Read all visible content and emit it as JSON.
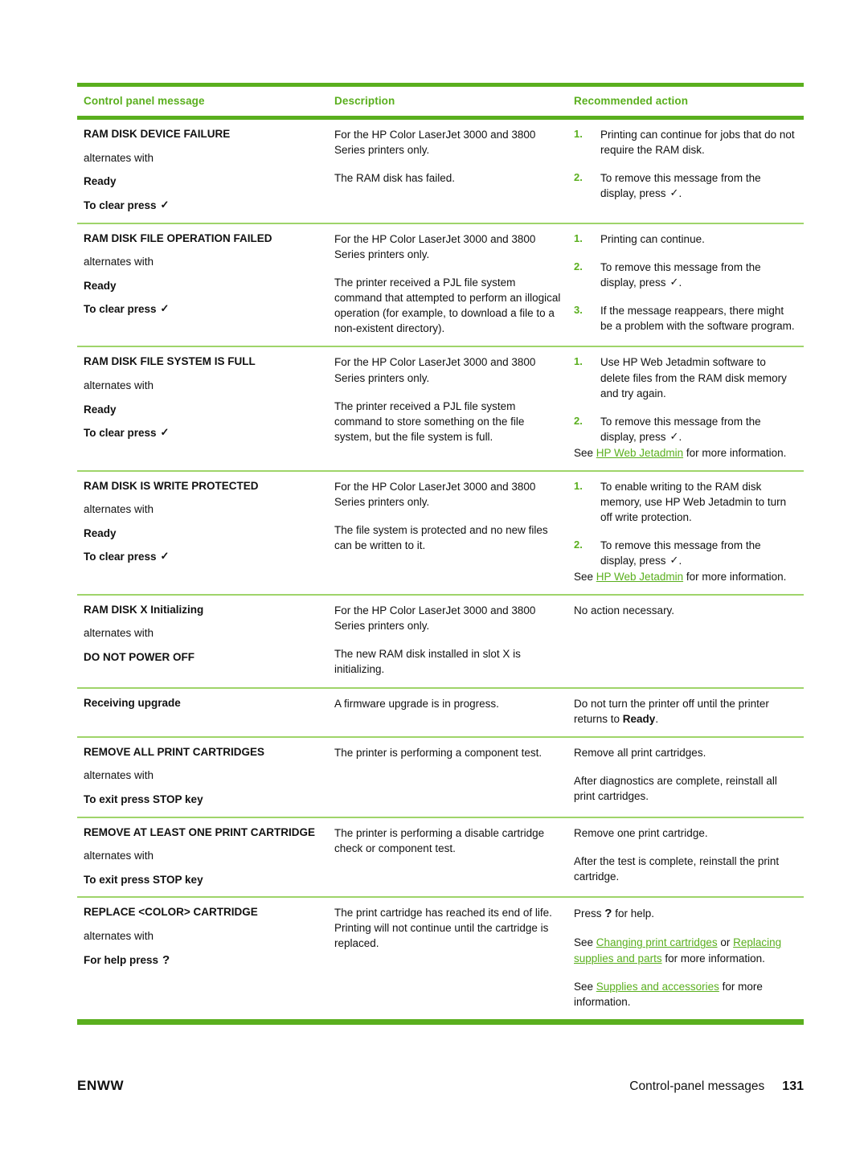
{
  "document": {
    "table": {
      "headers": {
        "col1": "Control panel message",
        "col2": "Description",
        "col3": "Recommended action"
      },
      "rows": [
        {
          "message": {
            "lines": [
              {
                "text": "RAM DISK DEVICE FAILURE",
                "style": "bold"
              },
              {
                "text": "alternates with",
                "style": "plain"
              },
              {
                "text": "Ready",
                "style": "bold"
              },
              {
                "text": "To clear press",
                "style": "bold",
                "glyph": "check"
              }
            ]
          },
          "description": [
            "For the HP Color LaserJet 3000 and 3800 Series printers only.",
            "The RAM disk has failed."
          ],
          "action_type": "list",
          "action_items": [
            {
              "num": "1.",
              "text": "Printing can continue for jobs that do not require the RAM disk."
            },
            {
              "num": "2.",
              "text": "To remove this message from the display, press",
              "glyph": "check",
              "tail": "."
            }
          ],
          "action_notes": []
        },
        {
          "message": {
            "lines": [
              {
                "text": "RAM DISK FILE OPERATION FAILED",
                "style": "bold"
              },
              {
                "text": "alternates with",
                "style": "plain"
              },
              {
                "text": "Ready",
                "style": "bold"
              },
              {
                "text": "To clear press",
                "style": "bold",
                "glyph": "check"
              }
            ]
          },
          "description": [
            "For the HP Color LaserJet 3000 and 3800 Series printers only.",
            "The printer received a PJL file system command that attempted to perform an illogical operation (for example, to download a file to a non-existent directory)."
          ],
          "action_type": "list",
          "action_items": [
            {
              "num": "1.",
              "text": "Printing can continue."
            },
            {
              "num": "2.",
              "text": "To remove this message from the display, press",
              "glyph": "check",
              "tail": "."
            },
            {
              "num": "3.",
              "text": "If the message reappears, there might be a problem with the software program."
            }
          ],
          "action_notes": []
        },
        {
          "message": {
            "lines": [
              {
                "text": "RAM DISK FILE SYSTEM IS FULL",
                "style": "bold"
              },
              {
                "text": "alternates with",
                "style": "plain"
              },
              {
                "text": "Ready",
                "style": "bold"
              },
              {
                "text": "To clear press",
                "style": "bold",
                "glyph": "check"
              }
            ]
          },
          "description": [
            "For the HP Color LaserJet 3000 and 3800 Series printers only.",
            "The printer received a PJL file system command to store something on the file system, but the file system is full."
          ],
          "action_type": "list",
          "action_items": [
            {
              "num": "1.",
              "text": "Use HP Web Jetadmin software to delete files from the RAM disk memory and try again."
            },
            {
              "num": "2.",
              "text": "To remove this message from the display, press",
              "glyph": "check",
              "tail": "."
            }
          ],
          "action_notes": [
            {
              "prefix": "See ",
              "link": "HP Web Jetadmin",
              "suffix": " for more information."
            }
          ]
        },
        {
          "message": {
            "lines": [
              {
                "text": "RAM DISK IS WRITE PROTECTED",
                "style": "bold"
              },
              {
                "text": "alternates with",
                "style": "plain"
              },
              {
                "text": "Ready",
                "style": "bold"
              },
              {
                "text": "To clear press",
                "style": "bold",
                "glyph": "check"
              }
            ]
          },
          "description": [
            "For the HP Color LaserJet 3000 and 3800 Series printers only.",
            "The file system is protected and no new files can be written to it."
          ],
          "action_type": "list",
          "action_items": [
            {
              "num": "1.",
              "text": "To enable writing to the RAM disk memory, use HP Web Jetadmin to turn off write protection."
            },
            {
              "num": "2.",
              "text": "To remove this message from the display, press",
              "glyph": "check",
              "tail": "."
            }
          ],
          "action_notes": [
            {
              "prefix": "See ",
              "link": "HP Web Jetadmin",
              "suffix": " for more information."
            }
          ]
        },
        {
          "message": {
            "lines": [
              {
                "text": "RAM DISK X Initializing",
                "style": "bold"
              },
              {
                "text": "alternates with",
                "style": "plain"
              },
              {
                "text": "DO NOT POWER OFF",
                "style": "bold"
              }
            ]
          },
          "description": [
            "For the HP Color LaserJet 3000 and 3800 Series printers only.",
            "The new RAM disk installed in slot X is initializing."
          ],
          "action_type": "text",
          "action_paragraphs": [
            "No action necessary."
          ],
          "action_notes": []
        },
        {
          "message": {
            "lines": [
              {
                "text": "Receiving upgrade",
                "style": "bold"
              }
            ]
          },
          "description": [
            "A firmware upgrade is in progress."
          ],
          "action_type": "rich",
          "action_rich": [
            {
              "parts": [
                {
                  "t": "Do not turn the printer off until the printer returns to ",
                  "b": false
                },
                {
                  "t": "Ready",
                  "b": true
                },
                {
                  "t": ".",
                  "b": false
                }
              ]
            }
          ],
          "action_notes": []
        },
        {
          "message": {
            "lines": [
              {
                "text": "REMOVE ALL PRINT CARTRIDGES",
                "style": "bold"
              },
              {
                "text": "alternates with",
                "style": "plain"
              },
              {
                "text": "To exit press STOP key",
                "style": "bold"
              }
            ]
          },
          "description": [
            "The printer is performing a component test."
          ],
          "action_type": "text",
          "action_paragraphs": [
            "Remove all print cartridges.",
            "After diagnostics are complete, reinstall all print cartridges."
          ],
          "action_notes": []
        },
        {
          "message": {
            "lines": [
              {
                "text": "REMOVE AT LEAST ONE PRINT CARTRIDGE",
                "style": "bold"
              },
              {
                "text": "alternates with",
                "style": "plain"
              },
              {
                "text": "To exit press STOP key",
                "style": "bold"
              }
            ]
          },
          "description": [
            "The printer is performing a disable cartridge check or component test."
          ],
          "action_type": "text",
          "action_paragraphs": [
            "Remove one print cartridge.",
            "After the test is complete, reinstall the print cartridge."
          ],
          "action_notes": []
        },
        {
          "message": {
            "lines": [
              {
                "text": "REPLACE <COLOR> CARTRIDGE",
                "style": "bold"
              },
              {
                "text": "alternates with",
                "style": "plain"
              },
              {
                "text": "For help press",
                "style": "bold",
                "glyph": "question"
              }
            ]
          },
          "description": [
            "The print cartridge has reached its end of life. Printing will not continue until the cartridge is replaced."
          ],
          "action_type": "press-help",
          "action_press": {
            "prefix": "Press ",
            "glyph": "question",
            "suffix": " for help."
          },
          "action_notes": [
            {
              "prefix": "See ",
              "link": "Changing print cartridges",
              "mid": " or ",
              "link2": "Replacing supplies and parts",
              "suffix": " for more information."
            },
            {
              "prefix": "See ",
              "link": "Supplies and accessories",
              "suffix": " for more information."
            }
          ]
        }
      ]
    },
    "footer": {
      "left": "ENWW",
      "section": "Control-panel messages",
      "page_number": "131"
    },
    "colors": {
      "accent_green": "#5aaf1e",
      "rule_light_green": "#9fd46a",
      "text": "#111111"
    },
    "glyphs": {
      "check": "✓",
      "question": "?"
    }
  }
}
